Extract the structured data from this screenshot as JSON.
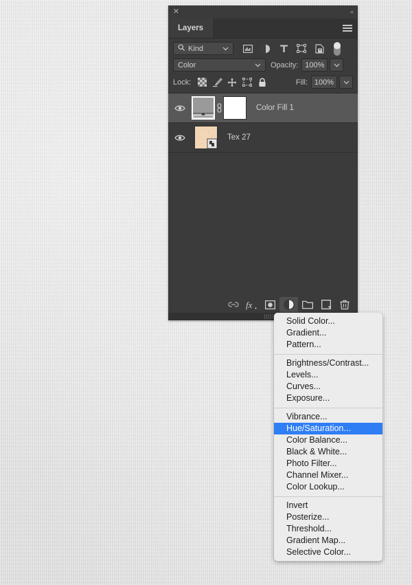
{
  "panel": {
    "title_tab": "Layers",
    "close_icon": "close-icon",
    "collapse_icon": "collapse-icon",
    "menu_icon": "panel-menu-icon",
    "filter": {
      "kind_label": "Kind",
      "search_icon": "search-icon",
      "caret": "⌄",
      "icons": [
        {
          "name": "filter-pixel-icon",
          "title": "Pixel layers"
        },
        {
          "name": "filter-adjustment-icon",
          "title": "Adjustment layers"
        },
        {
          "name": "filter-type-icon",
          "title": "Type layers"
        },
        {
          "name": "filter-shape-icon",
          "title": "Shape layers"
        },
        {
          "name": "filter-smartobject-icon",
          "title": "Smart objects"
        },
        {
          "name": "filter-toggle-switch",
          "title": "Turn filtering on/off"
        }
      ]
    },
    "blend": {
      "mode": "Color",
      "opacity_label": "Opacity:",
      "opacity_value": "100%",
      "caret": "⌄"
    },
    "lock": {
      "label": "Lock:",
      "fill_label": "Fill:",
      "fill_value": "100%",
      "icons": [
        {
          "name": "lock-transparency-icon"
        },
        {
          "name": "lock-image-icon"
        },
        {
          "name": "lock-position-icon"
        },
        {
          "name": "lock-artboard-icon"
        },
        {
          "name": "lock-all-icon"
        }
      ]
    },
    "layers": [
      {
        "name": "Color Fill 1",
        "visible": true,
        "selected": true,
        "thumb": "solid-color-fill",
        "thumb_color": "#9a9a9a",
        "mask_color": "#ffffff",
        "linked": true
      },
      {
        "name": "Tex 27",
        "visible": true,
        "selected": false,
        "thumb": "texture-image",
        "thumb_color": "#f0d3b2",
        "smart_object": true
      }
    ],
    "bottom_buttons": [
      {
        "name": "link-layers-button",
        "glyph": "link"
      },
      {
        "name": "layer-style-button",
        "glyph": "fx"
      },
      {
        "name": "add-layer-mask-button",
        "glyph": "mask"
      },
      {
        "name": "new-adjustment-layer-button",
        "glyph": "halfcircle",
        "active": true
      },
      {
        "name": "new-group-button",
        "glyph": "folder"
      },
      {
        "name": "new-layer-button",
        "glyph": "newlayer"
      },
      {
        "name": "delete-layer-button",
        "glyph": "trash"
      }
    ]
  },
  "adjustment_menu": {
    "highlighted": "Hue/Saturation...",
    "groups": [
      {
        "items": [
          "Solid Color...",
          "Gradient...",
          "Pattern..."
        ]
      },
      {
        "items": [
          "Brightness/Contrast...",
          "Levels...",
          "Curves...",
          "Exposure..."
        ]
      },
      {
        "items": [
          "Vibrance...",
          "Hue/Saturation...",
          "Color Balance...",
          "Black & White...",
          "Photo Filter...",
          "Channel Mixer...",
          "Color Lookup..."
        ]
      },
      {
        "items": [
          "Invert",
          "Posterize...",
          "Threshold...",
          "Gradient Map...",
          "Selective Color..."
        ]
      }
    ]
  },
  "colors": {
    "panel_bg": "#3b3b3b",
    "panel_header": "#333333",
    "selected_layer": "#585858",
    "menu_bg": "#ececec",
    "menu_highlight": "#2f7ef4",
    "backdrop": "#dddddd"
  }
}
